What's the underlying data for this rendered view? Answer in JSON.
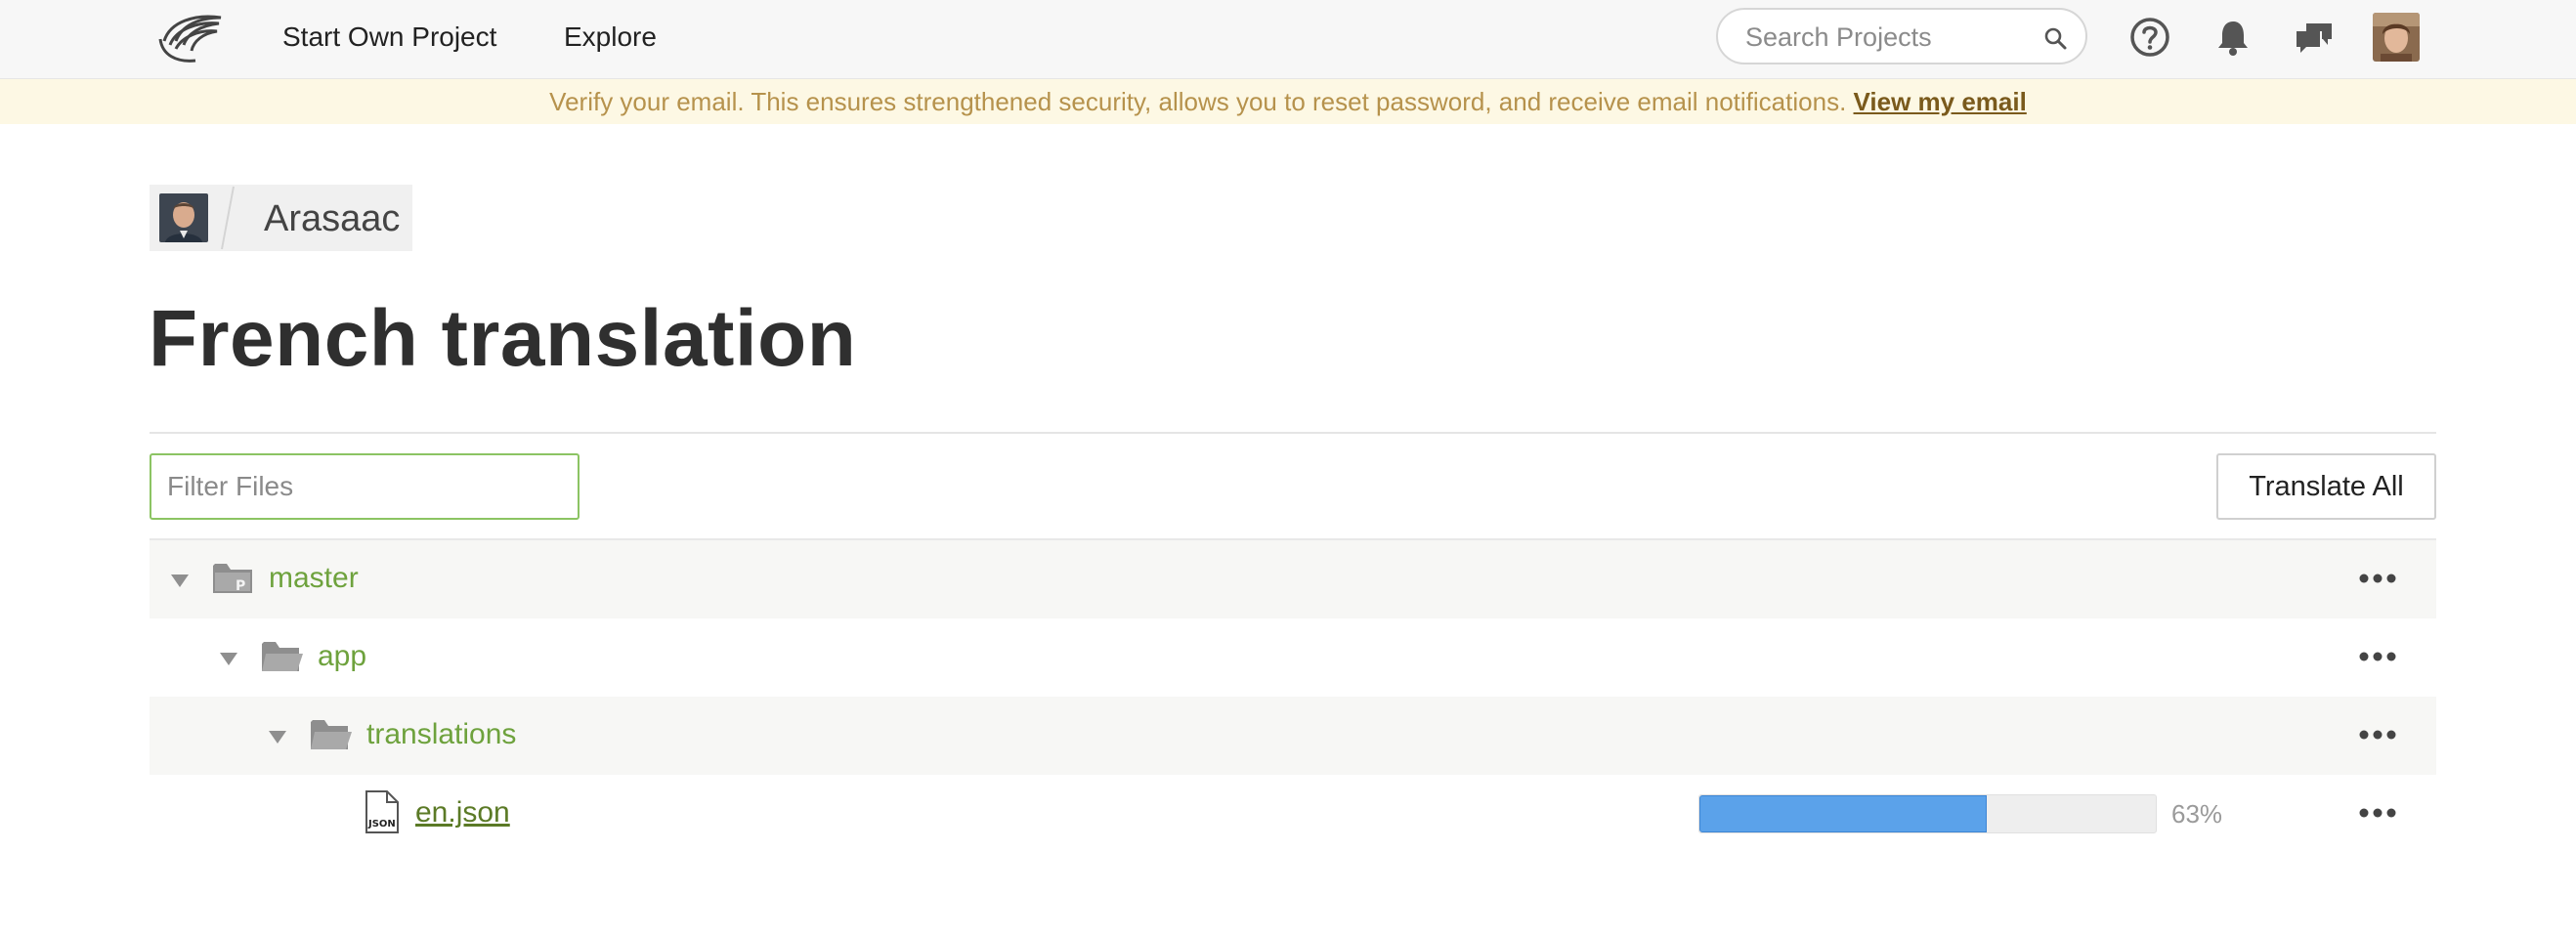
{
  "nav": {
    "start_project": "Start Own Project",
    "explore": "Explore",
    "search_placeholder": "Search Projects"
  },
  "icons": {
    "logo": "crowdin-swoosh-logo",
    "search": "search-icon",
    "help": "help-icon",
    "notifications": "bell-icon",
    "messages": "chat-icon",
    "user_avatar": "user-avatar"
  },
  "notice": {
    "text": "Verify your email. This ensures strengthened security, allows you to reset password, and receive email notifications. ",
    "link": "View my email"
  },
  "breadcrumb": {
    "project": "Arasaac"
  },
  "page": {
    "title": "French translation"
  },
  "toolbar": {
    "filter_placeholder": "Filter Files",
    "translate_all": "Translate All"
  },
  "tree": {
    "branch": {
      "name": "master"
    },
    "folder_app": {
      "name": "app"
    },
    "folder_translations": {
      "name": "translations"
    },
    "file": {
      "name": "en.json",
      "progress": 63,
      "progress_label": "63%"
    }
  },
  "colors": {
    "accent_green": "#6ea23d",
    "progress_blue": "#5ba2ea",
    "notice_bg": "#fdf8e4"
  }
}
